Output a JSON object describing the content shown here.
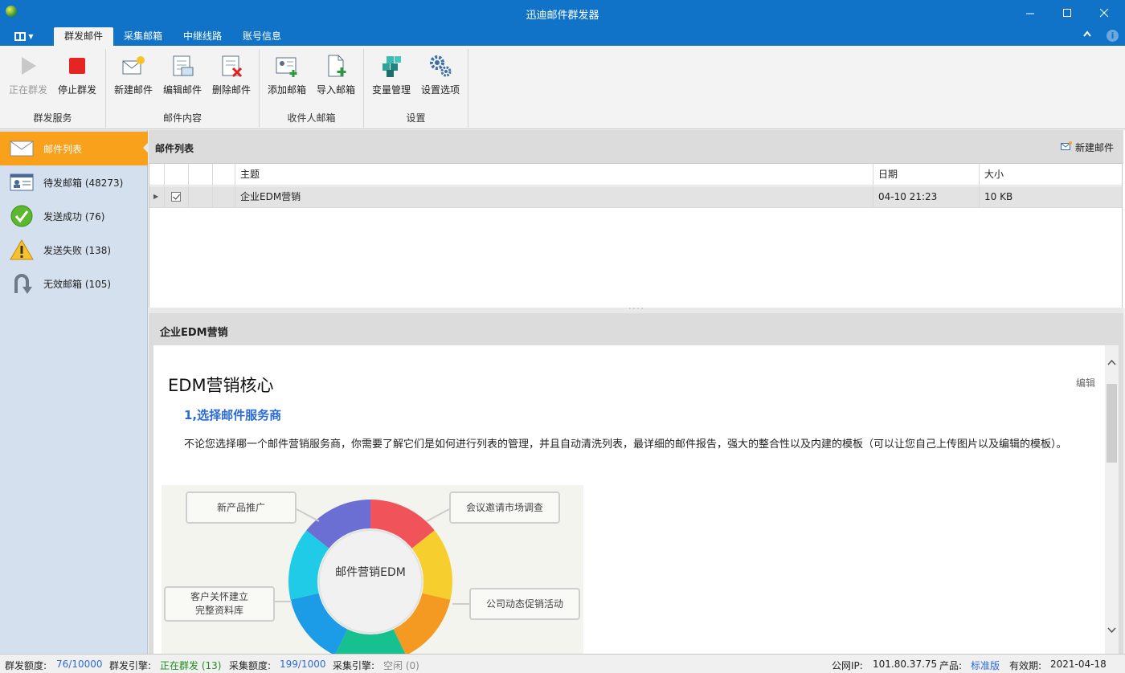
{
  "window": {
    "title": "迅迪邮件群发器"
  },
  "tabs": [
    {
      "label": "群发邮件"
    },
    {
      "label": "采集邮箱"
    },
    {
      "label": "中继线路"
    },
    {
      "label": "账号信息"
    }
  ],
  "ribbon": {
    "groups": [
      {
        "label": "群发服务",
        "buttons": [
          {
            "label": "正在群发",
            "icon": "play-icon"
          },
          {
            "label": "停止群发",
            "icon": "stop-icon"
          }
        ]
      },
      {
        "label": "邮件内容",
        "buttons": [
          {
            "label": "新建邮件",
            "icon": "new-mail-icon"
          },
          {
            "label": "编辑邮件",
            "icon": "edit-mail-icon"
          },
          {
            "label": "删除邮件",
            "icon": "delete-mail-icon"
          }
        ]
      },
      {
        "label": "收件人邮箱",
        "buttons": [
          {
            "label": "添加邮箱",
            "icon": "add-contact-icon"
          },
          {
            "label": "导入邮箱",
            "icon": "import-file-icon"
          }
        ]
      },
      {
        "label": "设置",
        "buttons": [
          {
            "label": "变量管理",
            "icon": "cubes-icon"
          },
          {
            "label": "设置选项",
            "icon": "gears-icon"
          }
        ]
      }
    ]
  },
  "sidebar": {
    "items": [
      {
        "label": "邮件列表",
        "icon": "envelope-icon"
      },
      {
        "label": "待发邮箱 (48273)",
        "icon": "contact-card-icon"
      },
      {
        "label": "发送成功 (76)",
        "icon": "check-circle-icon"
      },
      {
        "label": "发送失败 (138)",
        "icon": "warning-icon"
      },
      {
        "label": "无效邮箱 (105)",
        "icon": "u-turn-icon"
      }
    ]
  },
  "list": {
    "title": "邮件列表",
    "new_mail_label": "新建邮件",
    "columns": {
      "subject": "主题",
      "date": "日期",
      "size": "大小"
    },
    "rows": [
      {
        "subject": "企业EDM营销",
        "date": "04-10 21:23",
        "size": "10 KB",
        "checked": true
      }
    ]
  },
  "preview": {
    "title": "企业EDM营销",
    "edit_label": "编辑",
    "heading": "EDM营销核心",
    "subheading": "1,选择邮件服务商",
    "paragraph": "不论您选择哪一个邮件营销服务商，你需要了解它们是如何进行列表的管理，并且自动清洗列表，最详细的邮件报告，强大的整合性以及内建的模板（可以让您自己上传图片以及编辑的模板）。",
    "figure": {
      "center": "邮件营销EDM",
      "boxes": [
        "新产品推广",
        "会议邀请市场调查",
        "客户关怀建立\n完整资料库",
        "公司动态促销活动"
      ],
      "ring_colors": [
        "#f0545a",
        "#f6cf2e",
        "#f49a22",
        "#16c08f",
        "#1c9be6",
        "#1fcbe6",
        "#6b6fd4"
      ]
    }
  },
  "status": {
    "quota_label": "群发额度:",
    "quota_value": "76/10000",
    "engine_label": "群发引擎:",
    "engine_value": "正在群发 (13)",
    "collect_quota_label": "采集额度:",
    "collect_quota_value": "199/1000",
    "collect_engine_label": "采集引擎:",
    "collect_engine_value": "空闲 (0)",
    "ip_label": "公网IP:",
    "ip_value": "101.80.37.75",
    "product_label": "产品:",
    "product_value": "标准版",
    "expiry_label": "有效期:",
    "expiry_value": "2021-04-18"
  },
  "colors": {
    "titlebar": "#1173c7",
    "active_nav": "#f9a11b",
    "sidebar": "#d5e0ef",
    "link_blue": "#2b6bd8",
    "running_green": "#1c8c1c"
  }
}
